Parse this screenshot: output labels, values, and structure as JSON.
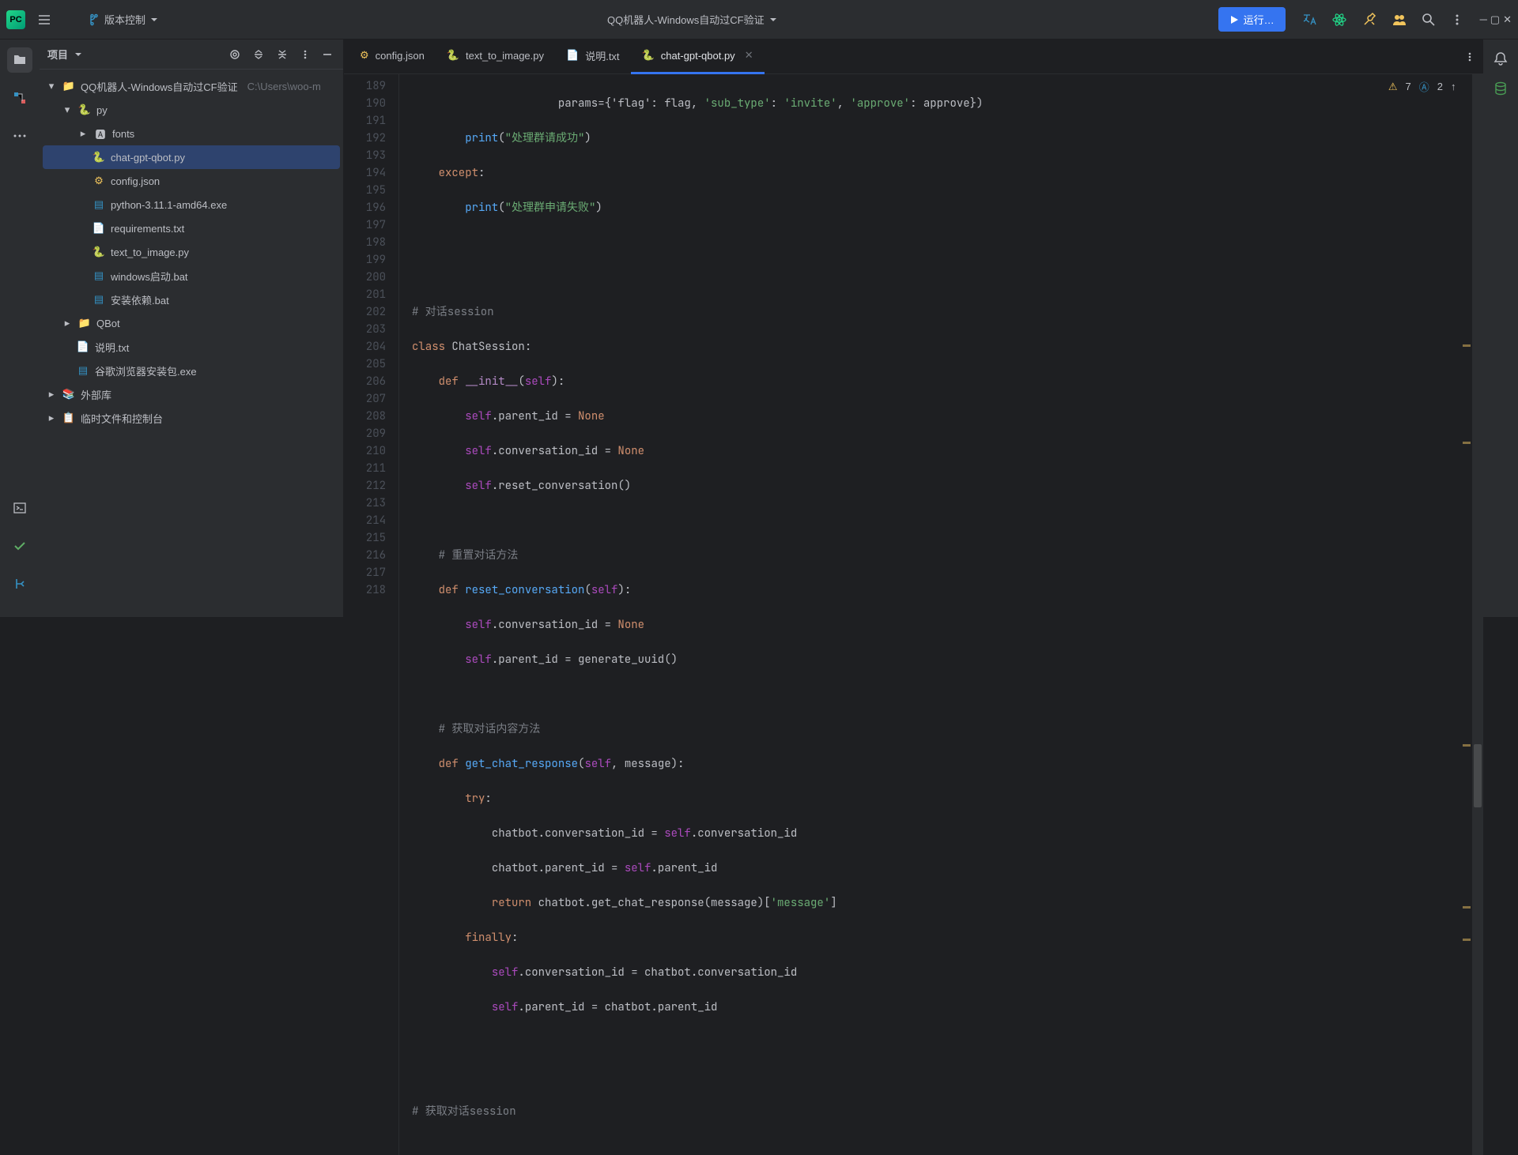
{
  "titlebar": {
    "vc_label": "版本控制",
    "project_name": "QQ机器人-Windows自动过CF验证",
    "run_label": "运行…"
  },
  "project": {
    "panel_title": "项目",
    "root": "QQ机器人-Windows自动过CF验证",
    "root_hint": "C:\\Users\\woo-m",
    "nodes": {
      "py": "py",
      "fonts": "fonts",
      "cgq": "chat-gpt-qbot.py",
      "config": "config.json",
      "pyamd": "python-3.11.1-amd64.exe",
      "req": "requirements.txt",
      "tti": "text_to_image.py",
      "winbat": "windows启动.bat",
      "install": "安装依赖.bat",
      "qbot": "QBot",
      "readme": "说明.txt",
      "chrome": "谷歌浏览器安装包.exe",
      "ext": "外部库",
      "scratch": "临时文件和控制台"
    }
  },
  "tabs": {
    "t0": "config.json",
    "t1": "text_to_image.py",
    "t2": "说明.txt",
    "t3": "chat-gpt-qbot.py"
  },
  "status": {
    "warnings": "7",
    "hints": "2"
  },
  "gutter": {
    "start": 189
  },
  "code": {
    "l0_a": "params",
    "l0_b": "={'flag': flag, ",
    "l0_c": "'sub_type'",
    "l0_d": ": ",
    "l0_e": "'invite'",
    "l0_f": ", ",
    "l0_g": "'approve'",
    "l0_h": ": approve})",
    "l1_a": "print",
    "l1_b": "(",
    "l1_c": "\"处理群请成功\"",
    "l1_d": ")",
    "l2_a": "except",
    "l2_b": ":",
    "l3_a": "print",
    "l3_b": "(",
    "l3_c": "\"处理群申请失败\"",
    "l3_d": ")",
    "l6_a": "# 对话session",
    "l7_a": "class ",
    "l7_b": "ChatSession",
    "l7_c": ":",
    "l8_a": "def ",
    "l8_b": "__init__",
    "l8_c": "(",
    "l8_d": "self",
    "l8_e": "):",
    "l9_a": "self",
    "l9_b": ".parent_id = ",
    "l9_c": "None",
    "l10_a": "self",
    "l10_b": ".conversation_id = ",
    "l10_c": "None",
    "l11_a": "self",
    "l11_b": ".reset_conversation()",
    "l13_a": "# 重置对话方法",
    "l14_a": "def ",
    "l14_b": "reset_conversation",
    "l14_c": "(",
    "l14_d": "self",
    "l14_e": "):",
    "l15_a": "self",
    "l15_b": ".conversation_id = ",
    "l15_c": "None",
    "l16_a": "self",
    "l16_b": ".parent_id = generate_uuid()",
    "l18_a": "# 获取对话内容方法",
    "l19_a": "def ",
    "l19_b": "get_chat_response",
    "l19_c": "(",
    "l19_d": "self",
    "l19_e": ", message):",
    "l20_a": "try",
    "l20_b": ":",
    "l21_a": "chatbot.conversation_id = ",
    "l21_b": "self",
    "l21_c": ".conversation_id",
    "l22_a": "chatbot.parent_id = ",
    "l22_b": "self",
    "l22_c": ".parent_id",
    "l23_a": "return ",
    "l23_b": "chatbot.get_chat_response(message)[",
    "l23_c": "'message'",
    "l23_d": "]",
    "l24_a": "finally",
    "l24_b": ":",
    "l25_a": "self",
    "l25_b": ".conversation_id = chatbot.conversation_id",
    "l26_a": "self",
    "l26_b": ".parent_id = chatbot.parent_id",
    "l29_a": "# 获取对话session"
  }
}
